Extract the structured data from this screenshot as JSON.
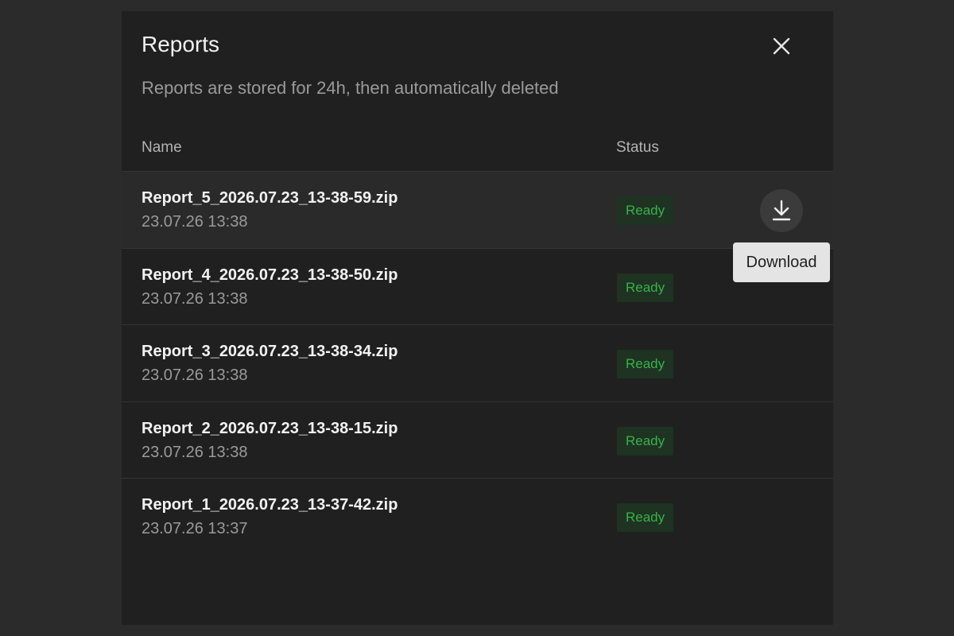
{
  "dialog": {
    "title": "Reports",
    "subtitle": "Reports are stored for 24h, then automatically deleted",
    "close_icon": "close-icon"
  },
  "table": {
    "columns": {
      "name": "Name",
      "status": "Status"
    },
    "rows": [
      {
        "name": "Report_5_2026.07.23_13-38-59.zip",
        "date": "23.07.26 13:38",
        "status": "Ready"
      },
      {
        "name": "Report_4_2026.07.23_13-38-50.zip",
        "date": "23.07.26 13:38",
        "status": "Ready"
      },
      {
        "name": "Report_3_2026.07.23_13-38-34.zip",
        "date": "23.07.26 13:38",
        "status": "Ready"
      },
      {
        "name": "Report_2_2026.07.23_13-38-15.zip",
        "date": "23.07.26 13:38",
        "status": "Ready"
      },
      {
        "name": "Report_1_2026.07.23_13-37-42.zip",
        "date": "23.07.26 13:37",
        "status": "Ready"
      }
    ]
  },
  "download": {
    "icon": "download-icon",
    "tooltip": "Download"
  },
  "colors": {
    "background": "#2b2b2b",
    "dialog": "#202020",
    "status_ready_text": "#38b24a",
    "status_ready_bg": "#1e3322"
  }
}
